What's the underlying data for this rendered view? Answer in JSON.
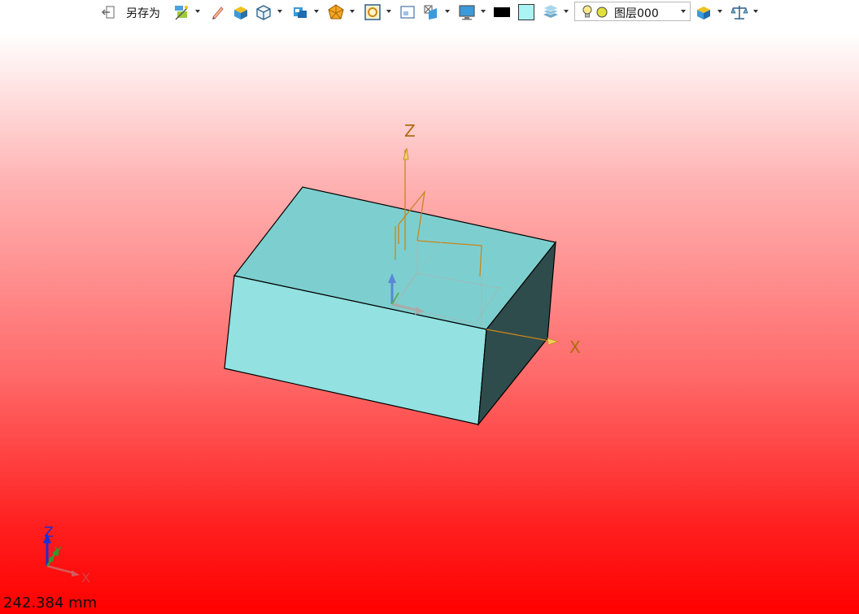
{
  "toolbar": {
    "save_as_label": "另存为",
    "layer_name": "图层000",
    "items": [
      {
        "icon": "export-icon"
      },
      {
        "icon": "magic-wand-icon"
      },
      {
        "icon": "pencil-icon"
      },
      {
        "icon": "render-box-icon"
      },
      {
        "icon": "wireframe-cube-icon"
      },
      {
        "icon": "view-cube-icon"
      },
      {
        "icon": "polygon-icon"
      },
      {
        "icon": "zoom-fit-icon"
      },
      {
        "icon": "image-icon"
      },
      {
        "icon": "flip-icon"
      },
      {
        "icon": "monitor-icon"
      },
      {
        "icon": "black-color-swatch"
      },
      {
        "icon": "cyan-color-swatch"
      },
      {
        "icon": "layers-icon"
      },
      {
        "icon": "lightbulb-icon"
      },
      {
        "icon": "material-icon"
      },
      {
        "icon": "balance-icon"
      }
    ],
    "colors": {
      "line_color": "#000000",
      "face_color": "#aaf4f4"
    }
  },
  "viewport": {
    "background_top": "#ffffff",
    "background_bottom": "#ff0000",
    "object_face_color": "#8fe0e0",
    "datum_axis_labels": {
      "z": "Z",
      "x": "X"
    },
    "triad_labels": {
      "z": "Z",
      "y": "Y",
      "x": "X"
    }
  },
  "status": {
    "distance": "242.384 mm"
  }
}
